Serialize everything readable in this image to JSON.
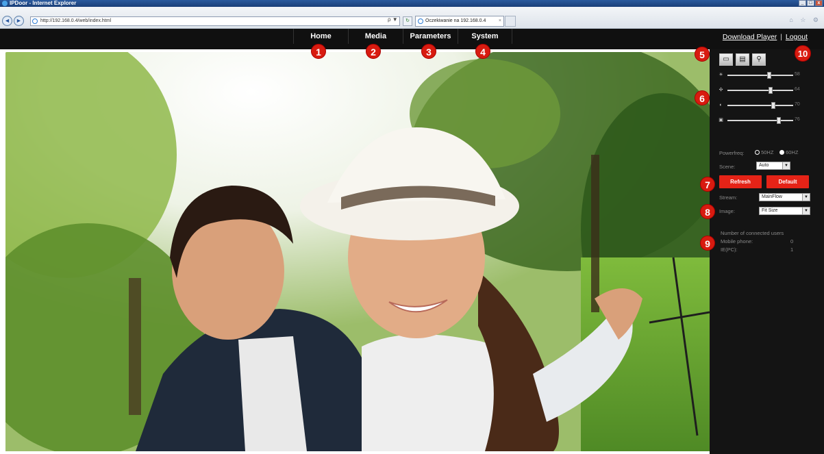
{
  "window": {
    "title": "IPDoor - Internet Explorer",
    "controls": [
      "_",
      "□",
      "x"
    ]
  },
  "browser": {
    "back_glyph": "◄",
    "forward_glyph": "►",
    "url": "http://192.168.0.4/web/index.html",
    "search_glyph": "ρ ▼",
    "refresh_glyph": "↻",
    "tab_title": "Oczekiwanie na 192.168.0.4",
    "tab_close": "×",
    "tools_glyphs": "⌂ ☆ ⚙"
  },
  "nav": {
    "items": [
      "Home",
      "Media",
      "Parameters",
      "System"
    ]
  },
  "header_links": {
    "download": "Download Player",
    "separator": "|",
    "logout": "Logout"
  },
  "panel": {
    "tool_glyphs": [
      "▭",
      "▤",
      "⚲"
    ],
    "sliders": [
      {
        "icon": "brightness-icon",
        "glyph": "☀",
        "value": 58
      },
      {
        "icon": "contrast-icon",
        "glyph": "✣",
        "value": 64
      },
      {
        "icon": "saturation-icon",
        "glyph": "◐",
        "value": 70
      },
      {
        "icon": "hue-icon",
        "glyph": "▣",
        "value": 76
      }
    ],
    "powerfreq_label": "Powerfreq:",
    "powerfreq_50": "50HZ",
    "powerfreq_60": "60HZ",
    "powerfreq_selected": "50HZ",
    "scene_label": "Scene:",
    "scene_value": "Auto",
    "refresh_label": "Refresh",
    "default_label": "Default",
    "stream_label": "Stream:",
    "stream_value": "MainFlow",
    "image_label": "Image:",
    "image_value": "Fit Size",
    "connected_title": "Number of connected users",
    "mobile_label": "Mobile phone:",
    "mobile_count": "0",
    "pc_label": "IE(PC):",
    "pc_count": "1"
  },
  "callouts": [
    "1",
    "2",
    "3",
    "4",
    "5",
    "6",
    "7",
    "8",
    "9",
    "10"
  ],
  "colors": {
    "accent_red": "#e52317",
    "header_bg": "#101010",
    "panel_bg": "#141414"
  }
}
